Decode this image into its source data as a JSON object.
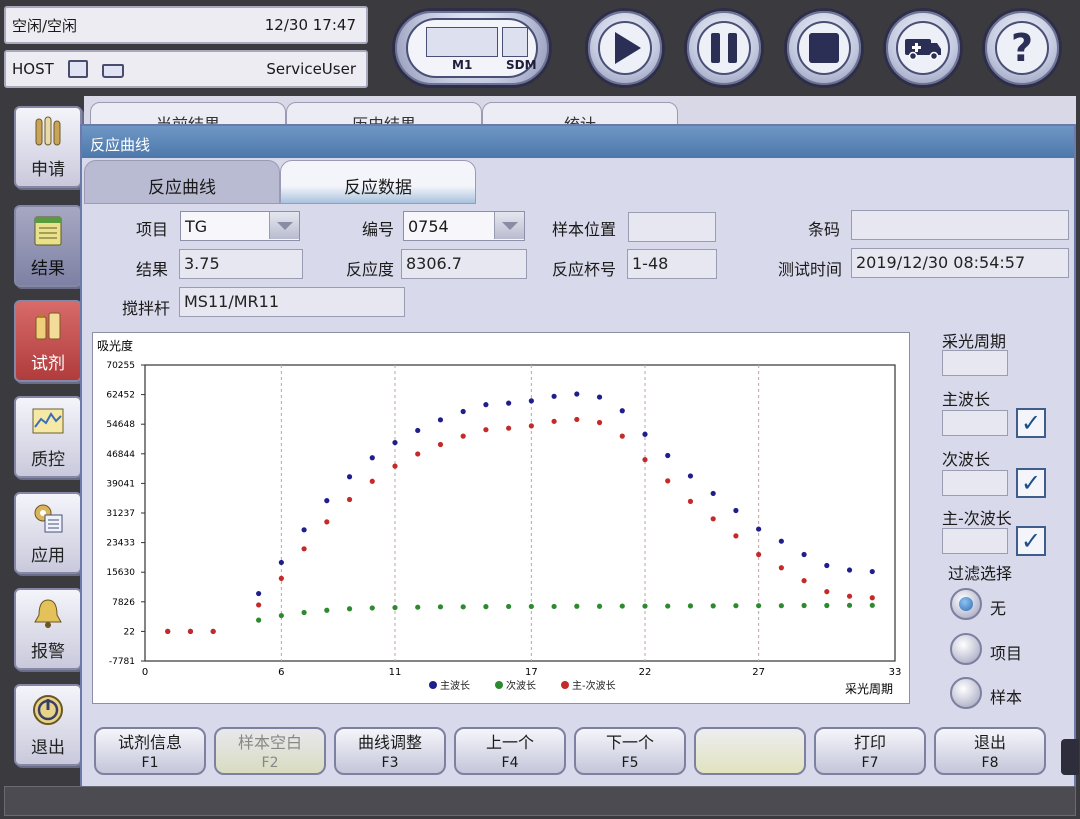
{
  "status": {
    "mode": "空闲/空闲",
    "datetime": "12/30 17:47"
  },
  "host": {
    "label": "HOST",
    "user": "ServiceUser"
  },
  "analyzer": {
    "module1": "M1",
    "module2": "SDM"
  },
  "sidebar": {
    "items": [
      {
        "label": "申请",
        "icon": "tubes-icon"
      },
      {
        "label": "结果",
        "icon": "notepad-icon"
      },
      {
        "label": "试剂",
        "icon": "reagent-bottles-icon"
      },
      {
        "label": "质控",
        "icon": "qc-chart-icon"
      },
      {
        "label": "应用",
        "icon": "gear-form-icon"
      },
      {
        "label": "报警",
        "icon": "bell-icon"
      },
      {
        "label": "退出",
        "icon": "power-icon"
      }
    ]
  },
  "bg_tabs": [
    "当前结果",
    "历史结果",
    "统计"
  ],
  "dialog": {
    "title": "反应曲线",
    "tabs": [
      "反应曲线",
      "反应数据"
    ],
    "fields": {
      "item_label": "项目",
      "item_value": "TG",
      "number_label": "编号",
      "number_value": "0754",
      "sample_pos_label": "样本位置",
      "sample_pos_value": "",
      "barcode_label": "条码",
      "barcode_value": "",
      "result_label": "结果",
      "result_value": "3.75",
      "absorbance_label": "反应度",
      "absorbance_value": "8306.7",
      "cuvette_label": "反应杯号",
      "cuvette_value": "1-48",
      "test_time_label": "测试时间",
      "test_time_value": "2019/12/30 08:54:57",
      "stirrer_label": "搅拌杆",
      "stirrer_value": "MS11/MR11"
    },
    "right": {
      "period_label": "采光周期",
      "main_wl_label": "主波长",
      "sub_wl_label": "次波长",
      "diff_wl_label": "主-次波长",
      "filter_label": "过滤选择",
      "filter_options": [
        {
          "label": "无",
          "selected": true
        },
        {
          "label": "项目",
          "selected": false
        },
        {
          "label": "样本",
          "selected": false
        }
      ]
    }
  },
  "chart_data": {
    "type": "scatter",
    "ylabel": "吸光度",
    "xlabel": "采光周期",
    "ylim": [
      -7781,
      70255
    ],
    "xlim": [
      0,
      33
    ],
    "yticks": [
      "70255",
      "62452",
      "54648",
      "46844",
      "39041",
      "31237",
      "23433",
      "15630",
      "7826",
      "22",
      "-7781"
    ],
    "xticks": [
      "0",
      "6",
      "11",
      "17",
      "22",
      "27",
      "33"
    ],
    "grid": "dashed vertical",
    "legend_position": "bottom-center",
    "series": [
      {
        "name": "主波长",
        "color": "#1f1f8c",
        "x": [
          1,
          2,
          3,
          5,
          6,
          7,
          8,
          9,
          10,
          11,
          12,
          13,
          14,
          15,
          16,
          17,
          18,
          19,
          20,
          21,
          22,
          23,
          24,
          25,
          26,
          27,
          28,
          29,
          30,
          31,
          32
        ],
        "y": [
          22,
          22,
          22,
          10000,
          18200,
          26800,
          34500,
          40800,
          45800,
          49800,
          53000,
          55800,
          58000,
          59800,
          60200,
          60800,
          62000,
          62600,
          61800,
          58200,
          52000,
          46400,
          41000,
          36400,
          31900,
          27000,
          23800,
          20300,
          17400,
          16200,
          15800
        ]
      },
      {
        "name": "次波长",
        "color": "#2e8a2e",
        "x": [
          5,
          6,
          7,
          8,
          9,
          10,
          11,
          12,
          13,
          14,
          15,
          16,
          17,
          18,
          19,
          20,
          21,
          22,
          23,
          24,
          25,
          26,
          27,
          28,
          29,
          30,
          31,
          32
        ],
        "y": [
          3000,
          4200,
          5000,
          5600,
          6000,
          6200,
          6300,
          6400,
          6500,
          6500,
          6550,
          6600,
          6600,
          6600,
          6650,
          6650,
          6700,
          6700,
          6700,
          6750,
          6750,
          6800,
          6800,
          6800,
          6850,
          6850,
          6900,
          6900
        ]
      },
      {
        "name": "主-次波长",
        "color": "#c42a2a",
        "x": [
          1,
          2,
          3,
          5,
          6,
          7,
          8,
          9,
          10,
          11,
          12,
          13,
          14,
          15,
          16,
          17,
          18,
          19,
          20,
          21,
          22,
          23,
          24,
          25,
          26,
          27,
          28,
          29,
          30,
          31,
          32
        ],
        "y": [
          22,
          22,
          22,
          7000,
          14000,
          21800,
          28900,
          34800,
          39600,
          43600,
          46800,
          49300,
          51500,
          53200,
          53600,
          54200,
          55400,
          55900,
          55100,
          51500,
          45300,
          39700,
          34300,
          29700,
          25200,
          20300,
          16800,
          13400,
          10500,
          9300,
          8900
        ]
      }
    ]
  },
  "fkeys": [
    {
      "label": "试剂信息",
      "key": "F1",
      "enabled": true
    },
    {
      "label": "样本空白",
      "key": "F2",
      "enabled": false
    },
    {
      "label": "曲线调整",
      "key": "F3",
      "enabled": true
    },
    {
      "label": "上一个",
      "key": "F4",
      "enabled": true
    },
    {
      "label": "下一个",
      "key": "F5",
      "enabled": true
    },
    {
      "label": "",
      "key": "",
      "enabled": false
    },
    {
      "label": "打印",
      "key": "F7",
      "enabled": true
    },
    {
      "label": "退出",
      "key": "F8",
      "enabled": true
    }
  ]
}
